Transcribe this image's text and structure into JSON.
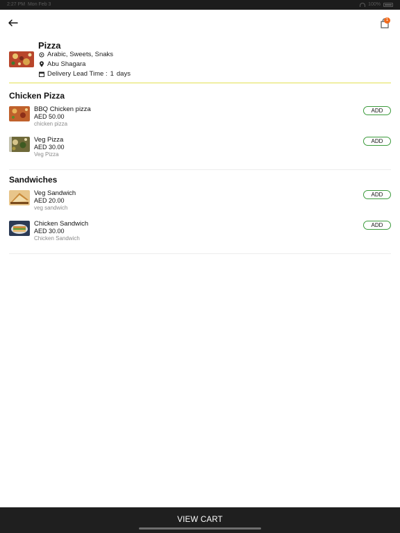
{
  "status_bar": {
    "time": "2:27 PM",
    "date": "Mon Feb 3",
    "battery": "100%"
  },
  "header": {
    "cart_count": "1"
  },
  "restaurant": {
    "name": "Pizza",
    "cuisines": "Arabic, Sweets, Snaks",
    "location": "Abu Shagara",
    "delivery_lead_label": "Delivery Lead Time :",
    "delivery_lead_value": "1",
    "delivery_lead_unit": "days"
  },
  "sections": [
    {
      "title": "Chicken Pizza",
      "items": [
        {
          "name": "BBQ Chicken pizza",
          "price": "AED 50.00",
          "description": "chicken pizza",
          "add_label": "ADD"
        },
        {
          "name": "Veg Pizza",
          "price": "AED 30.00",
          "description": "Veg Pizza",
          "add_label": "ADD"
        }
      ]
    },
    {
      "title": "Sandwiches",
      "items": [
        {
          "name": "Veg Sandwich",
          "price": "AED 20.00",
          "description": "veg sandwich",
          "add_label": "ADD"
        },
        {
          "name": "Chicken Sandwich",
          "price": "AED 30.00",
          "description": "Chicken Sandwich",
          "add_label": "ADD"
        }
      ]
    }
  ],
  "footer": {
    "view_cart_label": "VIEW CART"
  },
  "icons": {
    "back": "arrow-left-icon",
    "cart": "shopping-bag-icon",
    "cuisine": "tag-icon",
    "location": "map-pin-icon",
    "calendar": "calendar-icon"
  },
  "colors": {
    "accent_orange": "#f26b1d",
    "add_button_border": "#3a9a3a",
    "divider_yellow": "#e3e050",
    "footer_bg": "#1f1f1f"
  }
}
